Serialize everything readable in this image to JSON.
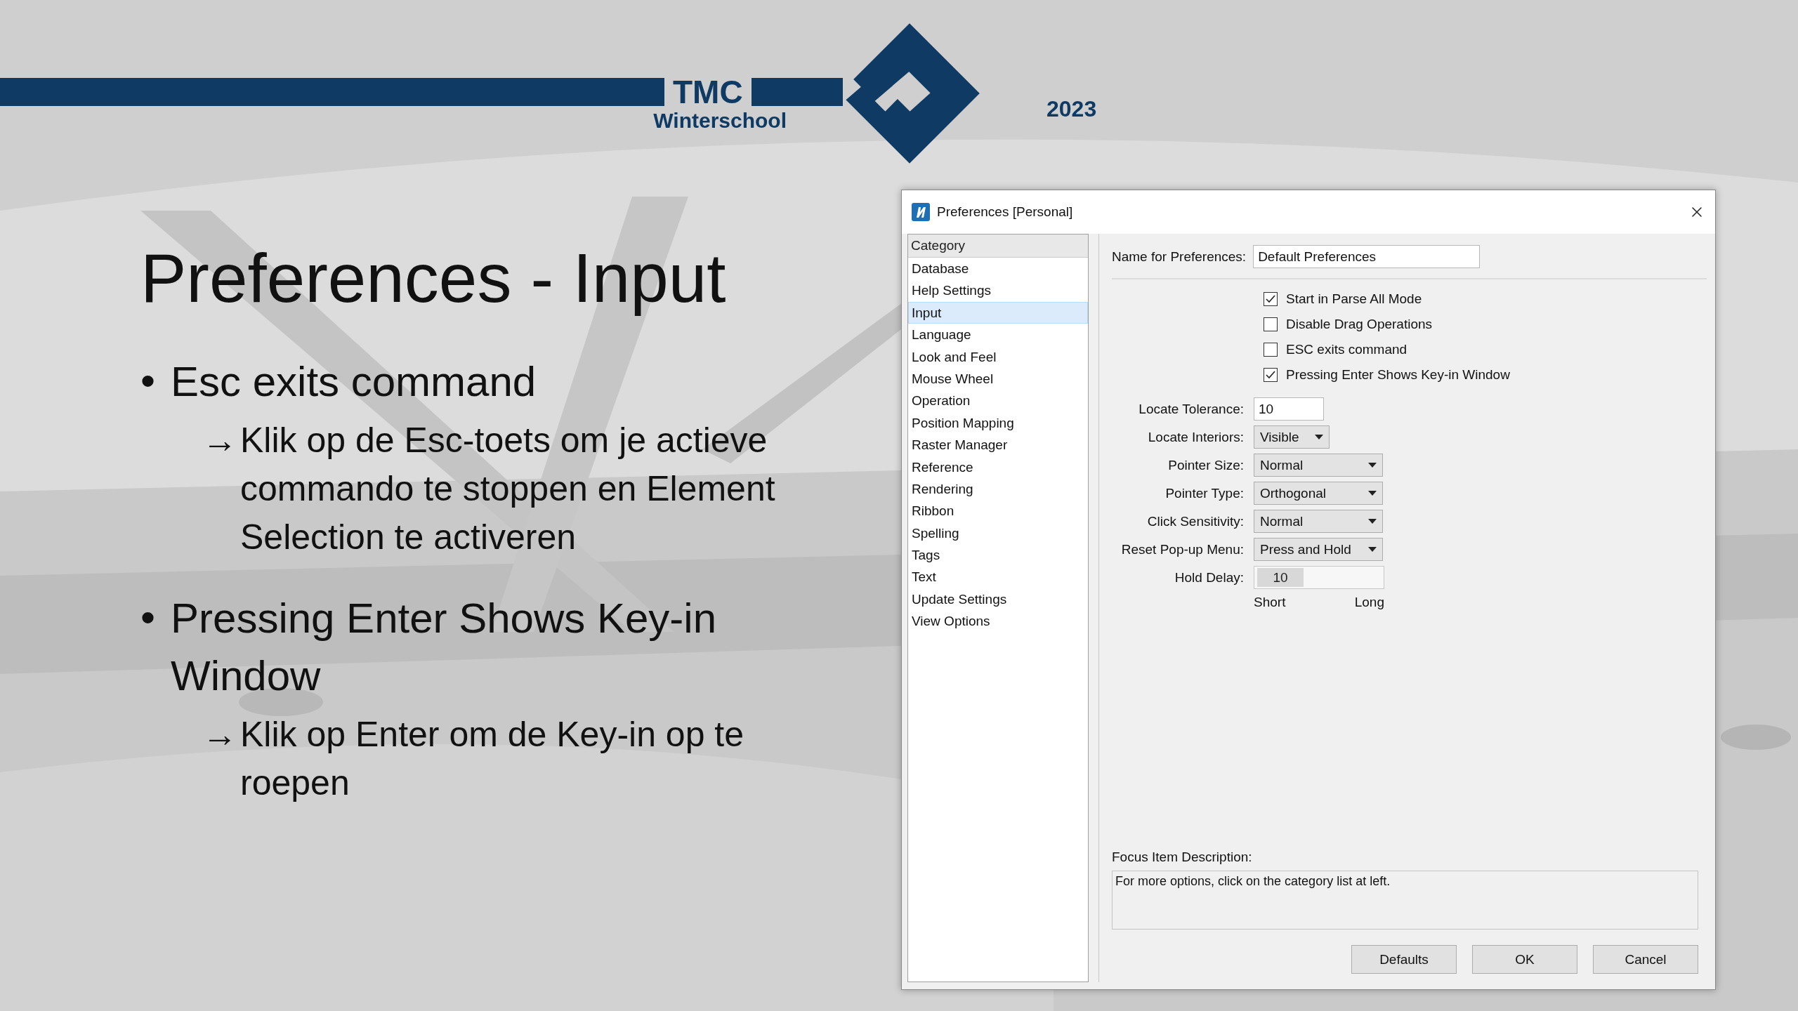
{
  "header": {
    "brand": "TMC",
    "subtitle": "Winterschool",
    "year": "2023"
  },
  "slide": {
    "title": "Preferences - Input",
    "bullets": [
      {
        "marker": "•",
        "text": "Esc exits command",
        "sub": [
          {
            "arrow": "→",
            "text": "Klik op de Esc-toets om je actieve commando te stoppen en Element Selection te activeren"
          }
        ]
      },
      {
        "marker": "•",
        "text": "Pressing Enter Shows Key-in Window",
        "sub": [
          {
            "arrow": "→",
            "text": "Klik op Enter om de Key-in op te roepen"
          }
        ]
      }
    ]
  },
  "dialog": {
    "title": "Preferences [Personal]",
    "category_header": "Category",
    "categories": [
      {
        "label": "Database",
        "selected": false
      },
      {
        "label": "Help Settings",
        "selected": false
      },
      {
        "label": "Input",
        "selected": true
      },
      {
        "label": "Language",
        "selected": false
      },
      {
        "label": "Look and Feel",
        "selected": false
      },
      {
        "label": "Mouse Wheel",
        "selected": false
      },
      {
        "label": "Operation",
        "selected": false
      },
      {
        "label": "Position Mapping",
        "selected": false
      },
      {
        "label": "Raster Manager",
        "selected": false
      },
      {
        "label": "Reference",
        "selected": false
      },
      {
        "label": "Rendering",
        "selected": false
      },
      {
        "label": "Ribbon",
        "selected": false
      },
      {
        "label": "Spelling",
        "selected": false
      },
      {
        "label": "Tags",
        "selected": false
      },
      {
        "label": "Text",
        "selected": false
      },
      {
        "label": "Update Settings",
        "selected": false
      },
      {
        "label": "View Options",
        "selected": false
      }
    ],
    "name_label": "Name for Preferences:",
    "name_value": "Default Preferences",
    "checkboxes": [
      {
        "label": "Start in Parse All Mode",
        "checked": true
      },
      {
        "label": "Disable Drag Operations",
        "checked": false
      },
      {
        "label": "ESC exits command",
        "checked": false
      },
      {
        "label": "Pressing Enter Shows Key-in Window",
        "checked": true
      }
    ],
    "settings": [
      {
        "kind": "text",
        "label": "Locate Tolerance:",
        "value": "10"
      },
      {
        "kind": "dropdown-small",
        "label": "Locate Interiors:",
        "value": "Visible"
      },
      {
        "kind": "dropdown",
        "label": "Pointer Size:",
        "value": "Normal"
      },
      {
        "kind": "dropdown",
        "label": "Pointer Type:",
        "value": "Orthogonal"
      },
      {
        "kind": "dropdown",
        "label": "Click Sensitivity:",
        "value": "Normal"
      },
      {
        "kind": "dropdown",
        "label": "Reset Pop-up Menu:",
        "value": "Press and Hold"
      },
      {
        "kind": "slider",
        "label": "Hold Delay:",
        "value": "10",
        "level": 0
      }
    ],
    "slider_min": "Short",
    "slider_max": "Long",
    "focus_label": "Focus Item Description:",
    "focus_text": "For more options, click on the category list at left.",
    "buttons": [
      "Defaults",
      "OK",
      "Cancel"
    ]
  }
}
